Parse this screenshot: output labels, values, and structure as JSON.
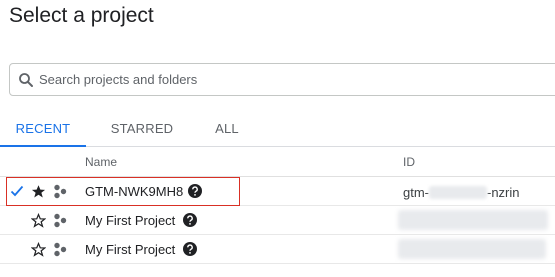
{
  "dialog": {
    "title": "Select a project"
  },
  "search": {
    "placeholder": "Search projects and folders",
    "icon": "search-icon"
  },
  "tabs": [
    {
      "label": "RECENT",
      "active": true
    },
    {
      "label": "STARRED",
      "active": false
    },
    {
      "label": "ALL",
      "active": false
    }
  ],
  "table": {
    "headers": {
      "name": "Name",
      "id": "ID"
    },
    "rows": [
      {
        "selected": true,
        "starred": true,
        "name": "GTM-NWK9MH8",
        "id_prefix": "gtm-",
        "id_suffix": "-nzrin",
        "id_redacted": true
      },
      {
        "selected": false,
        "starred": false,
        "name": "My First Project",
        "id_redacted": true
      },
      {
        "selected": false,
        "starred": false,
        "name": "My First Project",
        "id_redacted": true
      }
    ]
  },
  "colors": {
    "accent": "#1a73e8",
    "text": "#202124",
    "muted": "#5f6368",
    "highlight": "#d93025"
  }
}
